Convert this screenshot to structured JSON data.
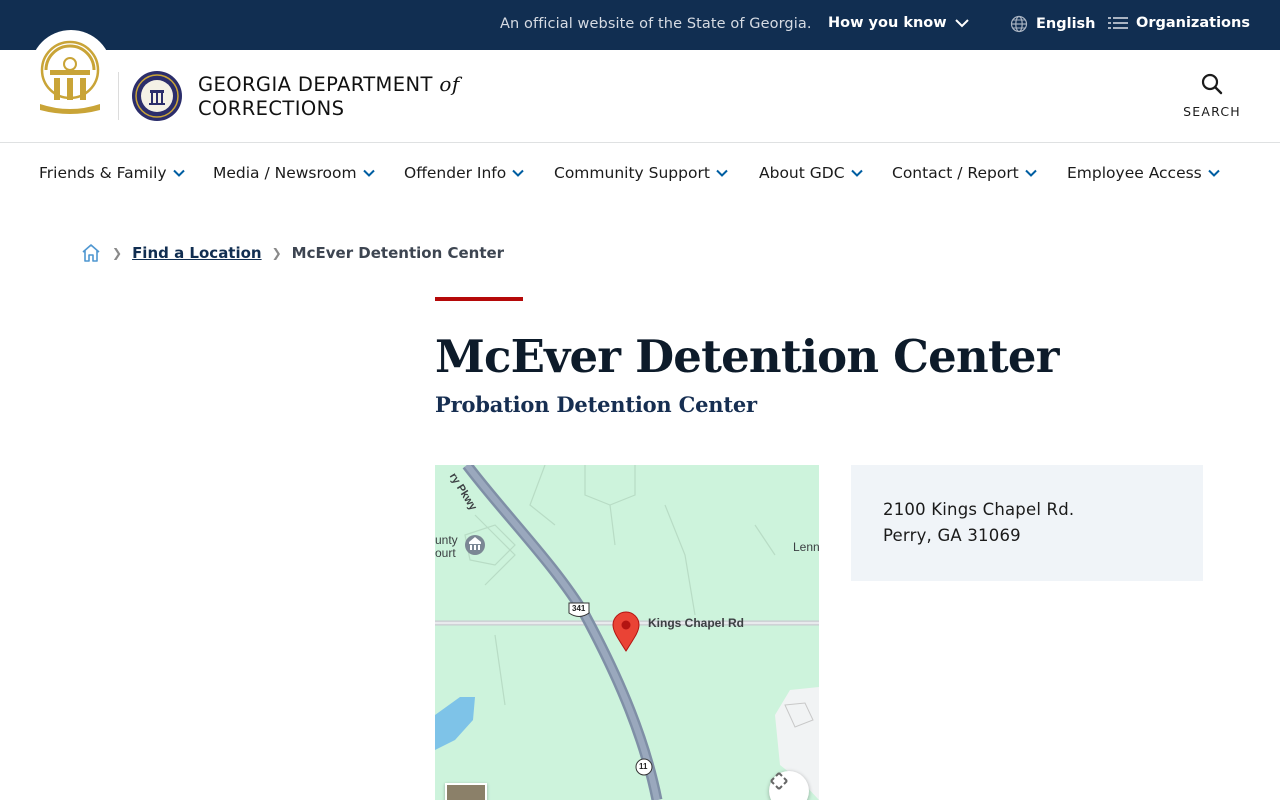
{
  "banner": {
    "official_text": "An official website of the State of Georgia.",
    "how_you_know": "How you know",
    "language": "English",
    "organizations": "Organizations"
  },
  "header": {
    "brand_line1": "GEORGIA DEPARTMENT",
    "brand_of": "of",
    "brand_line2": "CORRECTIONS",
    "search_label": "SEARCH"
  },
  "nav": {
    "items": [
      {
        "label": "Friends & Family"
      },
      {
        "label": "Media / Newsroom"
      },
      {
        "label": "Offender Info"
      },
      {
        "label": "Community Support"
      },
      {
        "label": "About GDC"
      },
      {
        "label": "Contact / Report"
      },
      {
        "label": "Employee Access"
      }
    ]
  },
  "breadcrumb": {
    "home": "home-icon",
    "link": "Find a Location",
    "current": "McEver Detention Center"
  },
  "page": {
    "title": "McEver Detention Center",
    "subtitle": "Probation Detention Center"
  },
  "map": {
    "parkway_label": "ry Pkwy",
    "court_label_1": "unty",
    "court_label_2": "ourt",
    "road_label": "Kings Chapel Rd",
    "edge_label": "Lenn",
    "shield_341": "341",
    "shield_11": "11"
  },
  "address": {
    "line1": "2100 Kings Chapel Rd.",
    "line2": "Perry, GA 31069"
  },
  "colors": {
    "banner_bg": "#112e51",
    "accent_red": "#b50909",
    "map_green": "#cdf3dc",
    "address_bg": "#f0f4f8",
    "nav_chevron": "#005ea2"
  }
}
